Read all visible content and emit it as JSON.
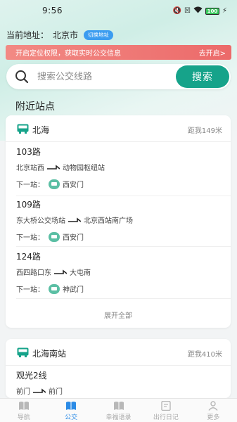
{
  "status_bar": {
    "time": "9:56",
    "battery": "100"
  },
  "location": {
    "label": "当前地址：",
    "city": "北京市",
    "switch_label": "切换地址"
  },
  "alert": {
    "text": "开启定位权限，获取实时公交信息",
    "action": "去开启>"
  },
  "search": {
    "placeholder": "搜索公交线路",
    "button_label": "搜索"
  },
  "nearby_title": "附近站点",
  "stations": [
    {
      "name": "北海",
      "distance": "距我149米",
      "routes": [
        {
          "name": "103路",
          "from": "北京站西",
          "to": "动物园枢纽站",
          "next_label": "下一站：",
          "next_stop": "西安门"
        },
        {
          "name": "109路",
          "from": "东大桥公交场站",
          "to": "北京西站南广场",
          "next_label": "下一站：",
          "next_stop": "西安门"
        },
        {
          "name": "124路",
          "from": "西四路口东",
          "to": "大屯南",
          "next_label": "下一站：",
          "next_stop": "神武门"
        }
      ],
      "expand_label": "展开全部"
    },
    {
      "name": "北海南站",
      "distance": "距我410米",
      "routes": [
        {
          "name": "观光2线",
          "from": "前门",
          "to": "前门"
        }
      ]
    }
  ],
  "tabs": [
    {
      "label": "导航",
      "icon": "book-icon"
    },
    {
      "label": "公交",
      "icon": "book-icon",
      "active": true
    },
    {
      "label": "幸福语录",
      "icon": "book-icon"
    },
    {
      "label": "出行日记",
      "icon": "note-icon"
    },
    {
      "label": "更多",
      "icon": "user-icon"
    }
  ],
  "colors": {
    "accent": "#16a38a",
    "tab_active": "#2b8be6",
    "alert": "#ec6a6a",
    "switch": "#3b9cf0"
  }
}
